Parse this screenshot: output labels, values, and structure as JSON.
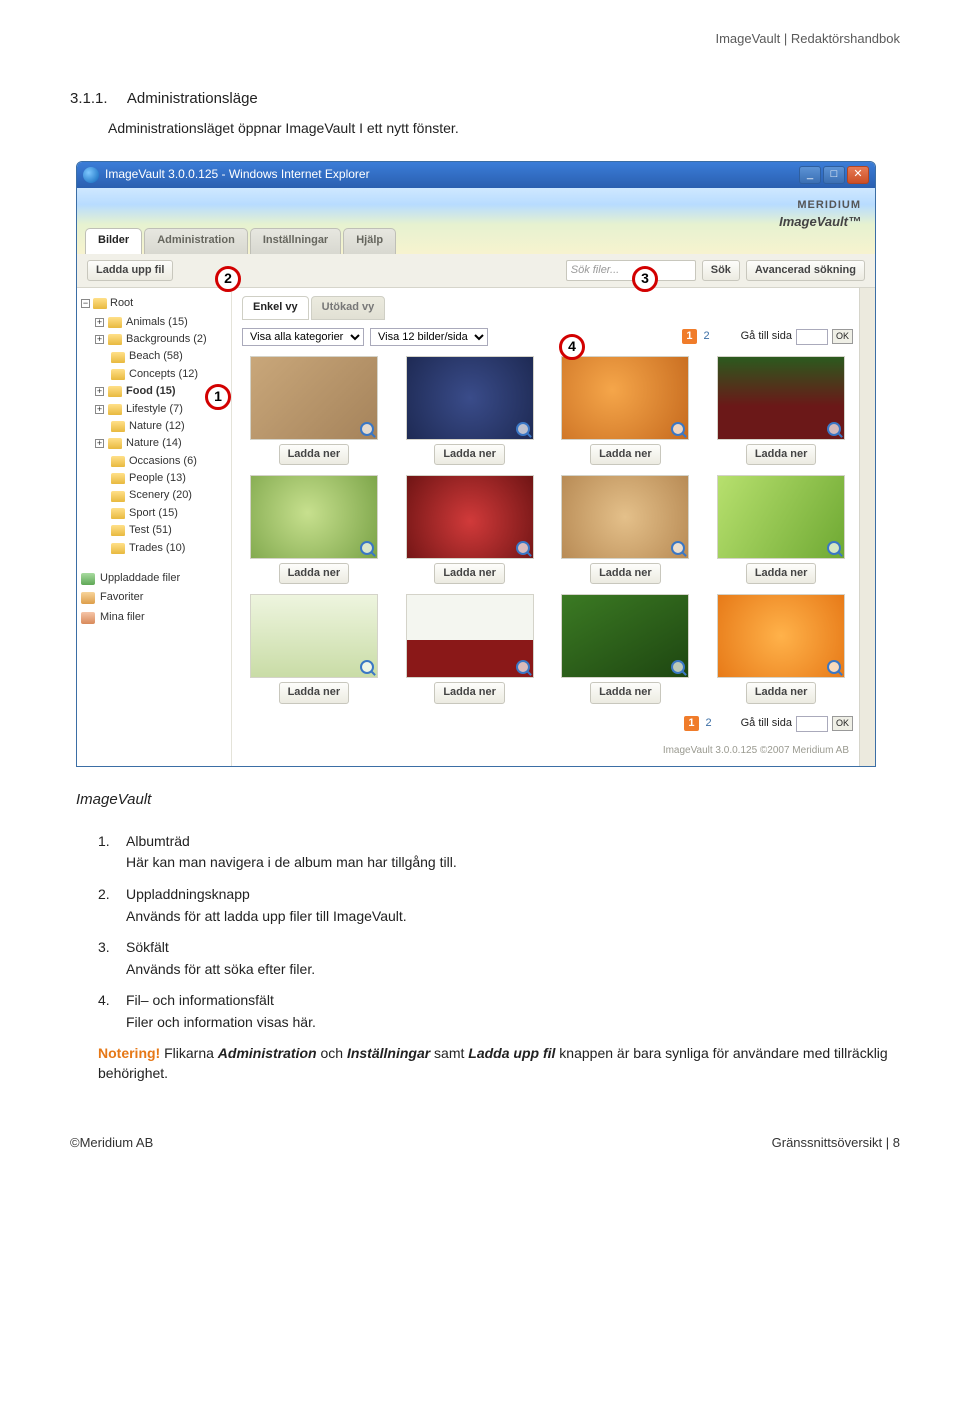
{
  "doc_header": "ImageVault | Redaktörshandbok",
  "section_number": "3.1.1.",
  "section_title": "Administrationsläge",
  "intro": "Administrationsläget öppnar ImageVault I ett nytt fönster.",
  "caption": "ImageVault",
  "callouts": {
    "c1": "1",
    "c2": "2",
    "c3": "3",
    "c4": "4"
  },
  "window": {
    "title": "ImageVault 3.0.0.125 - Windows Internet Explorer",
    "logo_brand": "MERIDIUM",
    "logo_product": "ImageVault™",
    "tabs": [
      "Bilder",
      "Administration",
      "Inställningar",
      "Hjälp"
    ],
    "upload_btn": "Ladda upp fil",
    "search_placeholder": "Sök filer...",
    "search_btn": "Sök",
    "adv_search_btn": "Avancerad sökning",
    "tree_root": "Root",
    "tree": [
      {
        "exp": "+",
        "label": "Animals (15)"
      },
      {
        "exp": "+",
        "label": "Backgrounds (2)"
      },
      {
        "exp": "",
        "label": "Beach (58)"
      },
      {
        "exp": "",
        "label": "Concepts (12)"
      },
      {
        "exp": "+",
        "label": "Food (15)",
        "bold": true
      },
      {
        "exp": "+",
        "label": "Lifestyle (7)"
      },
      {
        "exp": "",
        "label": "Nature (12)"
      },
      {
        "exp": "+",
        "label": "Nature (14)"
      },
      {
        "exp": "",
        "label": "Occasions (6)"
      },
      {
        "exp": "",
        "label": "People (13)"
      },
      {
        "exp": "",
        "label": "Scenery (20)"
      },
      {
        "exp": "",
        "label": "Sport (15)"
      },
      {
        "exp": "",
        "label": "Test (51)"
      },
      {
        "exp": "",
        "label": "Trades (10)"
      }
    ],
    "quick_links": [
      "Uppladdade filer",
      "Favoriter",
      "Mina filer"
    ],
    "subtabs": [
      "Enkel vy",
      "Utökad vy"
    ],
    "select_category": "Visa alla kategorier",
    "select_perpage": "Visa 12 bilder/sida",
    "page_current": "1",
    "page_other": "2",
    "goto_label": "Gå till sida",
    "goto_ok": "OK",
    "download_label": "Ladda ner",
    "status": "ImageVault 3.0.0.125 ©2007 Meridium AB"
  },
  "list": [
    {
      "n": "1.",
      "title": "Albumträd",
      "desc": "Här kan man navigera i de album man har tillgång till."
    },
    {
      "n": "2.",
      "title": "Uppladdningsknapp",
      "desc": "Används för att ladda upp filer till ImageVault."
    },
    {
      "n": "3.",
      "title": "Sökfält",
      "desc": "Används för att söka efter filer."
    },
    {
      "n": "4.",
      "title": "Fil– och informationsfält",
      "desc": "Filer och information visas här."
    }
  ],
  "note": {
    "label": "Notering!",
    "pre": " Flikarna ",
    "em1": "Administration",
    "mid1": " och ",
    "em2": "Inställningar",
    "mid2": " samt ",
    "em3": "Ladda upp fil",
    "post": " knappen är bara synliga för användare med tillräcklig behörighet."
  },
  "footer_left": "©Meridium AB",
  "footer_right": "Gränssnittsöversikt | 8"
}
